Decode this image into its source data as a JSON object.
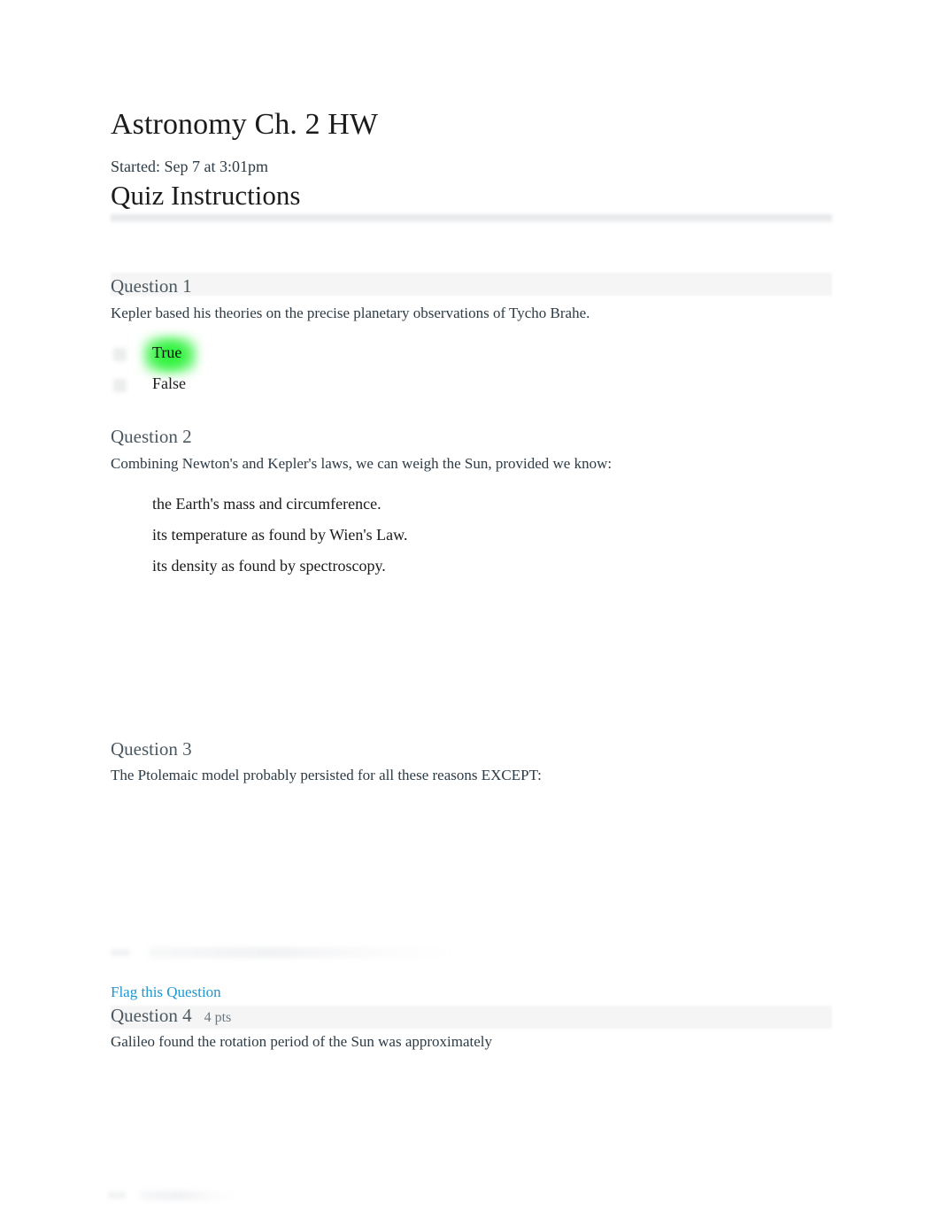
{
  "quiz": {
    "title": "Astronomy Ch. 2 HW",
    "started_label": "Started: Sep 7 at 3:01pm",
    "instructions_heading": "Quiz Instructions"
  },
  "colors": {
    "link_blue": "#2196cf",
    "highlight_green": "#2bf53a",
    "question_header_bg": "#f5f5f5",
    "question_title_text": "#4c5860",
    "body_text": "#2d3b45"
  },
  "questions": [
    {
      "title": "Question 1",
      "points": "",
      "prompt": "Kepler based his theories on the precise planetary observations of Tycho Brahe.",
      "answers": [
        {
          "label": "True",
          "highlighted": true
        },
        {
          "label": "False",
          "highlighted": false
        }
      ]
    },
    {
      "title": "Question 2",
      "points": "",
      "prompt": "Combining Newton's and Kepler's laws, we can weigh the Sun, provided we know:",
      "answers": [
        {
          "label": "the Earth's mass and circumference.",
          "highlighted": false
        },
        {
          "label": "its temperature as found by Wien's Law.",
          "highlighted": false
        },
        {
          "label": "its density as found by spectroscopy.",
          "highlighted": false
        }
      ]
    },
    {
      "title": "Question 3",
      "points": "",
      "prompt": "The Ptolemaic model probably persisted for all these reasons EXCEPT:",
      "answers": []
    },
    {
      "title": "Question 4",
      "points": "4 pts",
      "prompt": "Galileo found the rotation period of the Sun was approximately",
      "answers": []
    }
  ],
  "flag_link": {
    "label": "Flag this Question"
  }
}
